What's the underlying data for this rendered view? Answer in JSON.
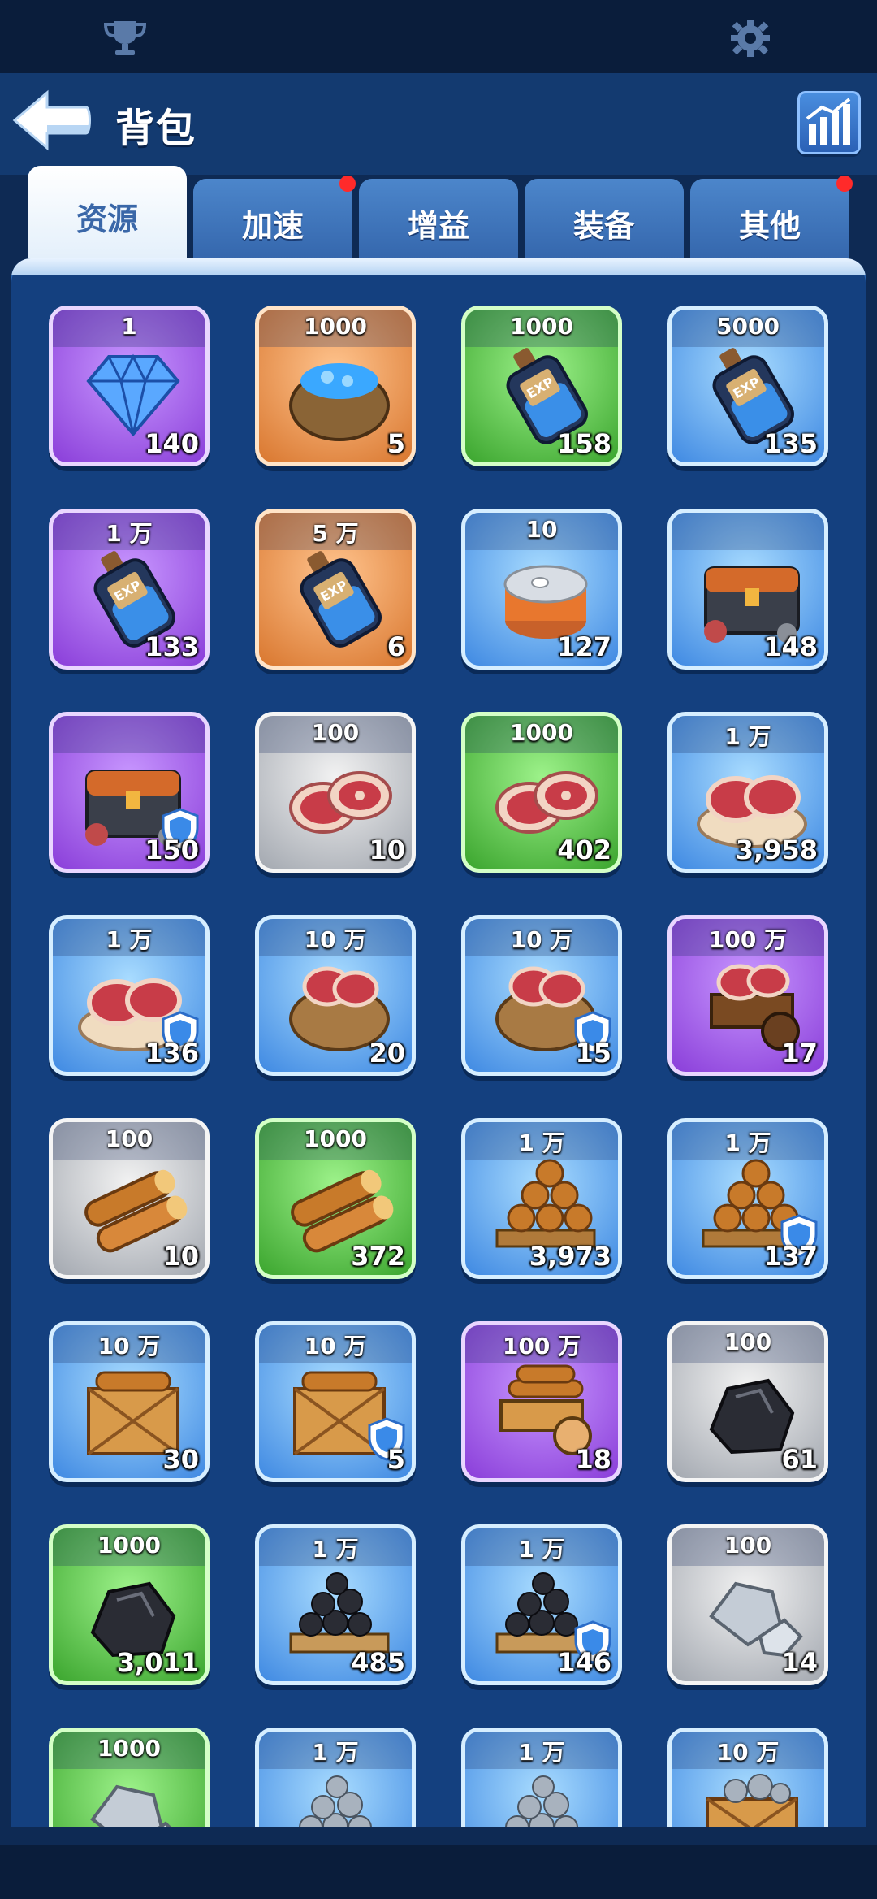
{
  "header": {
    "title": "背包"
  },
  "tabs": [
    {
      "label": "资源",
      "active": true,
      "badge": false
    },
    {
      "label": "加速",
      "active": false,
      "badge": true
    },
    {
      "label": "增益",
      "active": false,
      "badge": false
    },
    {
      "label": "装备",
      "active": false,
      "badge": false
    },
    {
      "label": "其他",
      "active": false,
      "badge": true
    }
  ],
  "items": [
    {
      "amount": "1",
      "count": "140",
      "quality": "purple",
      "icon": "diamond-icon",
      "shield": false
    },
    {
      "amount": "1000",
      "count": "5",
      "quality": "orange",
      "icon": "gem-sack-icon",
      "shield": false
    },
    {
      "amount": "1000",
      "count": "158",
      "quality": "green",
      "icon": "exp-potion-icon",
      "shield": false
    },
    {
      "amount": "5000",
      "count": "135",
      "quality": "blue",
      "icon": "exp-potion-icon",
      "shield": false
    },
    {
      "amount": "1 万",
      "count": "133",
      "quality": "purple",
      "icon": "exp-potion-icon",
      "shield": false
    },
    {
      "amount": "5 万",
      "count": "6",
      "quality": "orange",
      "icon": "exp-potion-icon",
      "shield": false
    },
    {
      "amount": "10",
      "count": "127",
      "quality": "blue",
      "icon": "can-icon",
      "shield": false
    },
    {
      "amount": "",
      "count": "148",
      "quality": "blue",
      "icon": "chest-icon",
      "shield": false
    },
    {
      "amount": "",
      "count": "150",
      "quality": "purple",
      "icon": "chest-icon",
      "shield": true
    },
    {
      "amount": "100",
      "count": "10",
      "quality": "grey",
      "icon": "meat-icon",
      "shield": false
    },
    {
      "amount": "1000",
      "count": "402",
      "quality": "green",
      "icon": "meat-icon",
      "shield": false
    },
    {
      "amount": "1 万",
      "count": "3,958",
      "quality": "blue",
      "icon": "meat-plate-icon",
      "shield": false
    },
    {
      "amount": "1 万",
      "count": "136",
      "quality": "blue",
      "icon": "meat-plate-icon",
      "shield": true
    },
    {
      "amount": "10 万",
      "count": "20",
      "quality": "blue",
      "icon": "meat-sack-icon",
      "shield": false
    },
    {
      "amount": "10 万",
      "count": "15",
      "quality": "blue",
      "icon": "meat-sack-icon",
      "shield": true
    },
    {
      "amount": "100 万",
      "count": "17",
      "quality": "purple",
      "icon": "meat-cart-icon",
      "shield": false
    },
    {
      "amount": "100",
      "count": "10",
      "quality": "grey",
      "icon": "wood-icon",
      "shield": false
    },
    {
      "amount": "1000",
      "count": "372",
      "quality": "green",
      "icon": "wood-icon",
      "shield": false
    },
    {
      "amount": "1 万",
      "count": "3,973",
      "quality": "blue",
      "icon": "wood-pallet-icon",
      "shield": false
    },
    {
      "amount": "1 万",
      "count": "137",
      "quality": "blue",
      "icon": "wood-pallet-icon",
      "shield": true
    },
    {
      "amount": "10 万",
      "count": "30",
      "quality": "blue",
      "icon": "wood-crate-icon",
      "shield": false
    },
    {
      "amount": "10 万",
      "count": "5",
      "quality": "blue",
      "icon": "wood-crate-icon",
      "shield": true
    },
    {
      "amount": "100 万",
      "count": "18",
      "quality": "purple",
      "icon": "wood-cart-icon",
      "shield": false
    },
    {
      "amount": "100",
      "count": "61",
      "quality": "grey",
      "icon": "coal-icon",
      "shield": false
    },
    {
      "amount": "1000",
      "count": "3,011",
      "quality": "green",
      "icon": "coal-icon",
      "shield": false
    },
    {
      "amount": "1 万",
      "count": "485",
      "quality": "blue",
      "icon": "coal-pallet-icon",
      "shield": false
    },
    {
      "amount": "1 万",
      "count": "146",
      "quality": "blue",
      "icon": "coal-pallet-icon",
      "shield": true
    },
    {
      "amount": "100",
      "count": "14",
      "quality": "grey",
      "icon": "stone-icon",
      "shield": false
    },
    {
      "amount": "1000",
      "count": "",
      "quality": "green",
      "icon": "stone-icon",
      "shield": false
    },
    {
      "amount": "1 万",
      "count": "",
      "quality": "blue",
      "icon": "stone-pallet-icon",
      "shield": false
    },
    {
      "amount": "1 万",
      "count": "",
      "quality": "blue",
      "icon": "stone-pallet-icon",
      "shield": false
    },
    {
      "amount": "10 万",
      "count": "",
      "quality": "blue",
      "icon": "stone-crate-icon",
      "shield": false
    }
  ]
}
